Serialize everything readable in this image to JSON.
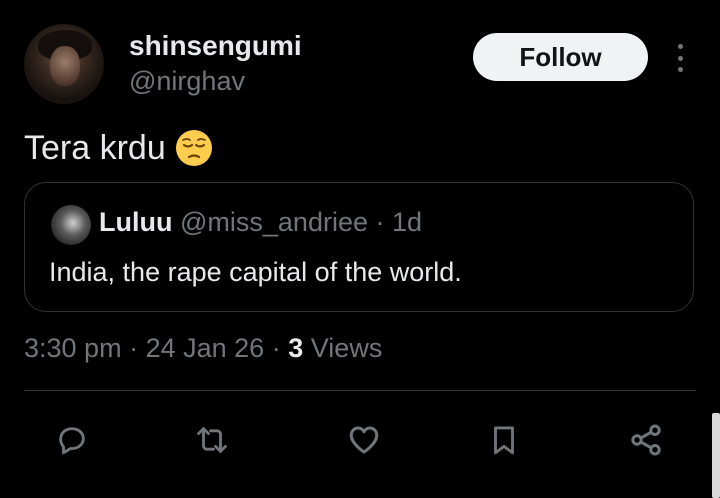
{
  "post": {
    "author_name": "shinsengumi",
    "author_handle": "@nirghav",
    "follow_label": "Follow",
    "text": "Tera krdu",
    "emoji": "pensive-face-emoji"
  },
  "quoted": {
    "name": "Luluu",
    "handle": "@miss_andriee",
    "separator": "·",
    "age": "1d",
    "text": "India, the rape capital of the world."
  },
  "meta": {
    "time": "3:30 pm",
    "sep1": "·",
    "date": "24 Jan 26",
    "sep2": "·",
    "views_count": "3",
    "views_label": "Views"
  },
  "actions": [
    {
      "name": "reply-icon"
    },
    {
      "name": "repost-icon"
    },
    {
      "name": "like-icon"
    },
    {
      "name": "bookmark-icon"
    },
    {
      "name": "share-icon"
    }
  ],
  "colors": {
    "background": "#000000",
    "text": "#e7e9ea",
    "muted": "#71767b",
    "border": "#2f3336",
    "follow_bg": "#eff3f4",
    "emoji": "#ffcc4d"
  }
}
